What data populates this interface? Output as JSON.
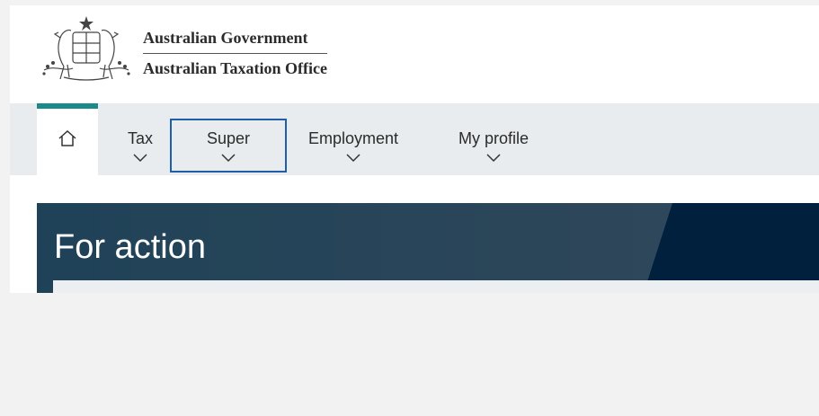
{
  "header": {
    "org_name": "Australian Government",
    "agency_name": "Australian Taxation Office",
    "logo_icon": "coat-of-arms-icon"
  },
  "nav": {
    "home_icon": "home-icon",
    "items": [
      {
        "label": "Tax",
        "icon": "chevron-down-icon"
      },
      {
        "label": "Super",
        "icon": "chevron-down-icon",
        "focused": true
      },
      {
        "label": "Employment",
        "icon": "chevron-down-icon"
      },
      {
        "label": "My profile",
        "icon": "chevron-down-icon"
      }
    ]
  },
  "banner": {
    "title": "For action"
  },
  "colors": {
    "accent_teal": "#1a8a8a",
    "focus_blue": "#1f5fa8",
    "banner_dark": "#00203d",
    "banner_mid": "#2b4a5e"
  }
}
